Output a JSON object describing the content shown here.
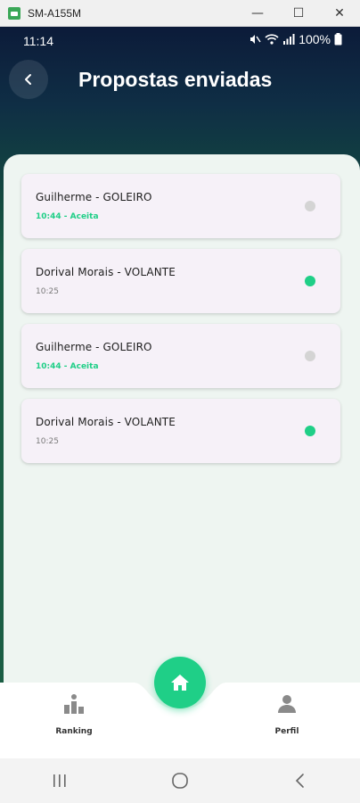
{
  "window": {
    "title": "SM-A155M",
    "minimize_glyph": "—",
    "maximize_glyph": "☐",
    "close_glyph": "✕"
  },
  "status_bar": {
    "time": "11:14",
    "battery": "100%",
    "icons": [
      "mute-icon",
      "wifi-icon",
      "signal-icon"
    ]
  },
  "header": {
    "back_icon": "chevron-left-icon",
    "title": "Propostas enviadas"
  },
  "proposals": [
    {
      "title": "Guilherme - GOLEIRO",
      "subtitle": "10:44 - Aceita",
      "accepted": true,
      "indicator": "gray"
    },
    {
      "title": "Dorival Morais - VOLANTE",
      "subtitle": "10:25",
      "accepted": false,
      "indicator": "green"
    },
    {
      "title": "Guilherme - GOLEIRO",
      "subtitle": "10:44 - Aceita",
      "accepted": true,
      "indicator": "gray"
    },
    {
      "title": "Dorival Morais - VOLANTE",
      "subtitle": "10:25",
      "accepted": false,
      "indicator": "green"
    }
  ],
  "bottom_nav": {
    "ranking_label": "Ranking",
    "profile_label": "Perfil",
    "home_icon": "home-icon"
  },
  "colors": {
    "accent": "#1fcf87",
    "indicator_gray": "#d4d4d4",
    "indicator_green": "#1fcf87",
    "card_bg": "#f6f1f8"
  }
}
